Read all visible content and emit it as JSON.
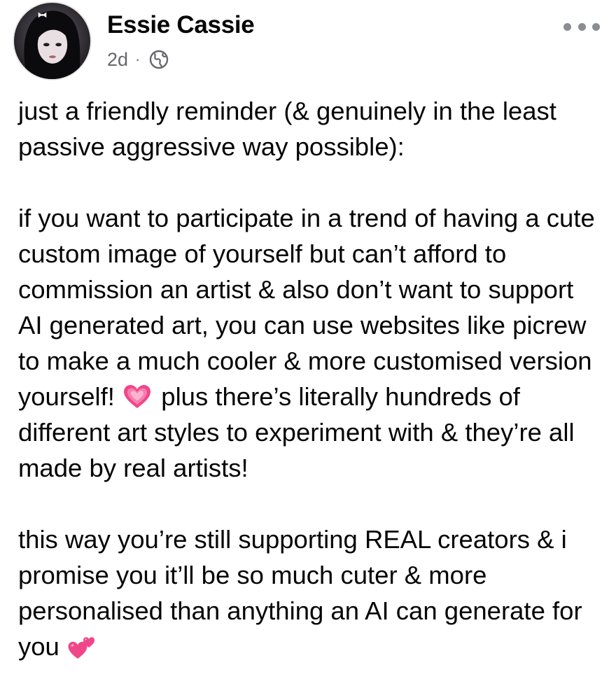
{
  "post": {
    "author": "Essie Cassie",
    "timestamp": "2d",
    "separator": "·",
    "audience_icon": "globe-icon",
    "more_icon": "more-options-icon",
    "paragraphs": [
      {
        "text": "just a friendly reminder (& genuinely in the least passive aggressive way possible):"
      },
      {
        "before": "if you want to participate in a trend of having a cute custom image of yourself but can’t afford to commission an artist & also don’t want to support AI generated art, you can use websites like picrew to make a much cooler & more customised version yourself!",
        "emoji": "growing-heart-emoji",
        "after": "plus there’s literally hundreds of different art styles to experiment with & they’re all made by real artists!"
      },
      {
        "before": "this way you’re still supporting REAL creators & i promise you it’ll be so much cuter & more personalised than anything an AI can generate for you",
        "emoji": "two-hearts-emoji"
      }
    ]
  },
  "colors": {
    "text": "#050505",
    "meta": "#65676b",
    "heart": "#f0478a"
  }
}
